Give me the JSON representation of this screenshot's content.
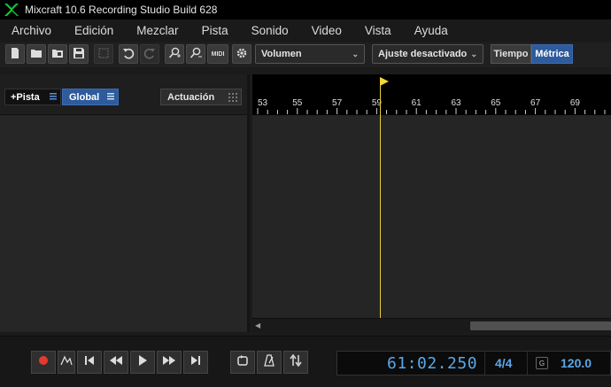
{
  "window": {
    "title": "Mixcraft 10.6 Recording Studio Build 628"
  },
  "menu": [
    "Archivo",
    "Edición",
    "Mezclar",
    "Pista",
    "Sonido",
    "Video",
    "Vista",
    "Ayuda"
  ],
  "toolbar": {
    "midi_label": "MIDI",
    "view_select": "Volumen",
    "snap_select": "Ajuste desactivado",
    "time_mode": "Tiempo",
    "metric_mode": "Métrica",
    "active_mode": "Métrica"
  },
  "left_panel": {
    "add_track_label": "+Pista",
    "global_label": "Global",
    "performance_label": "Actuación"
  },
  "ruler": {
    "markers": [
      "53",
      "55",
      "57",
      "59",
      "61",
      "63",
      "65",
      "67",
      "69"
    ]
  },
  "transport": {
    "time": "61:02.250",
    "signature": "4/4",
    "key": "G",
    "tempo": "120.0"
  },
  "colors": {
    "accent": "#2d5b9c",
    "lcd_text": "#5aa7ea",
    "playhead": "#e6cf3a",
    "record": "#e23b2e",
    "logo": "#19c43a"
  }
}
